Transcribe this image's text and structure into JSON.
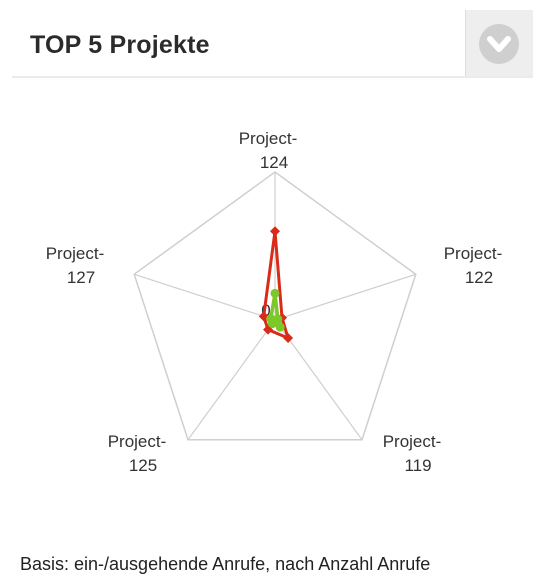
{
  "widget": {
    "title": "TOP 5 Projekte",
    "menu_icon": "chevron-down-circle-icon",
    "footnote": "Basis: ein-/ausgehende Anrufe, nach Anzahl Anrufe"
  },
  "colors": {
    "grid": "#cfcfcf",
    "series_red": "#d92b18",
    "series_green": "#7cc828",
    "menu_bg": "#eeeeee",
    "menu_circle": "#cfcfcf"
  },
  "chart_data": {
    "type": "radar",
    "title": "",
    "axes": [
      {
        "line1": "Project-",
        "line2": "124"
      },
      {
        "line1": "Project-",
        "line2": "122"
      },
      {
        "line1": "Project-",
        "line2": "119"
      },
      {
        "line1": "Project-",
        "line2": "125"
      },
      {
        "line1": "Project-",
        "line2": "127"
      }
    ],
    "center_label": "0",
    "range": [
      0,
      1
    ],
    "series": [
      {
        "color": "#d92b18",
        "values": [
          0.6,
          0.05,
          0.15,
          0.08,
          0.08
        ]
      },
      {
        "color": "#7cc828",
        "values": [
          0.18,
          0.02,
          0.06,
          0.03,
          0.03
        ]
      }
    ]
  }
}
